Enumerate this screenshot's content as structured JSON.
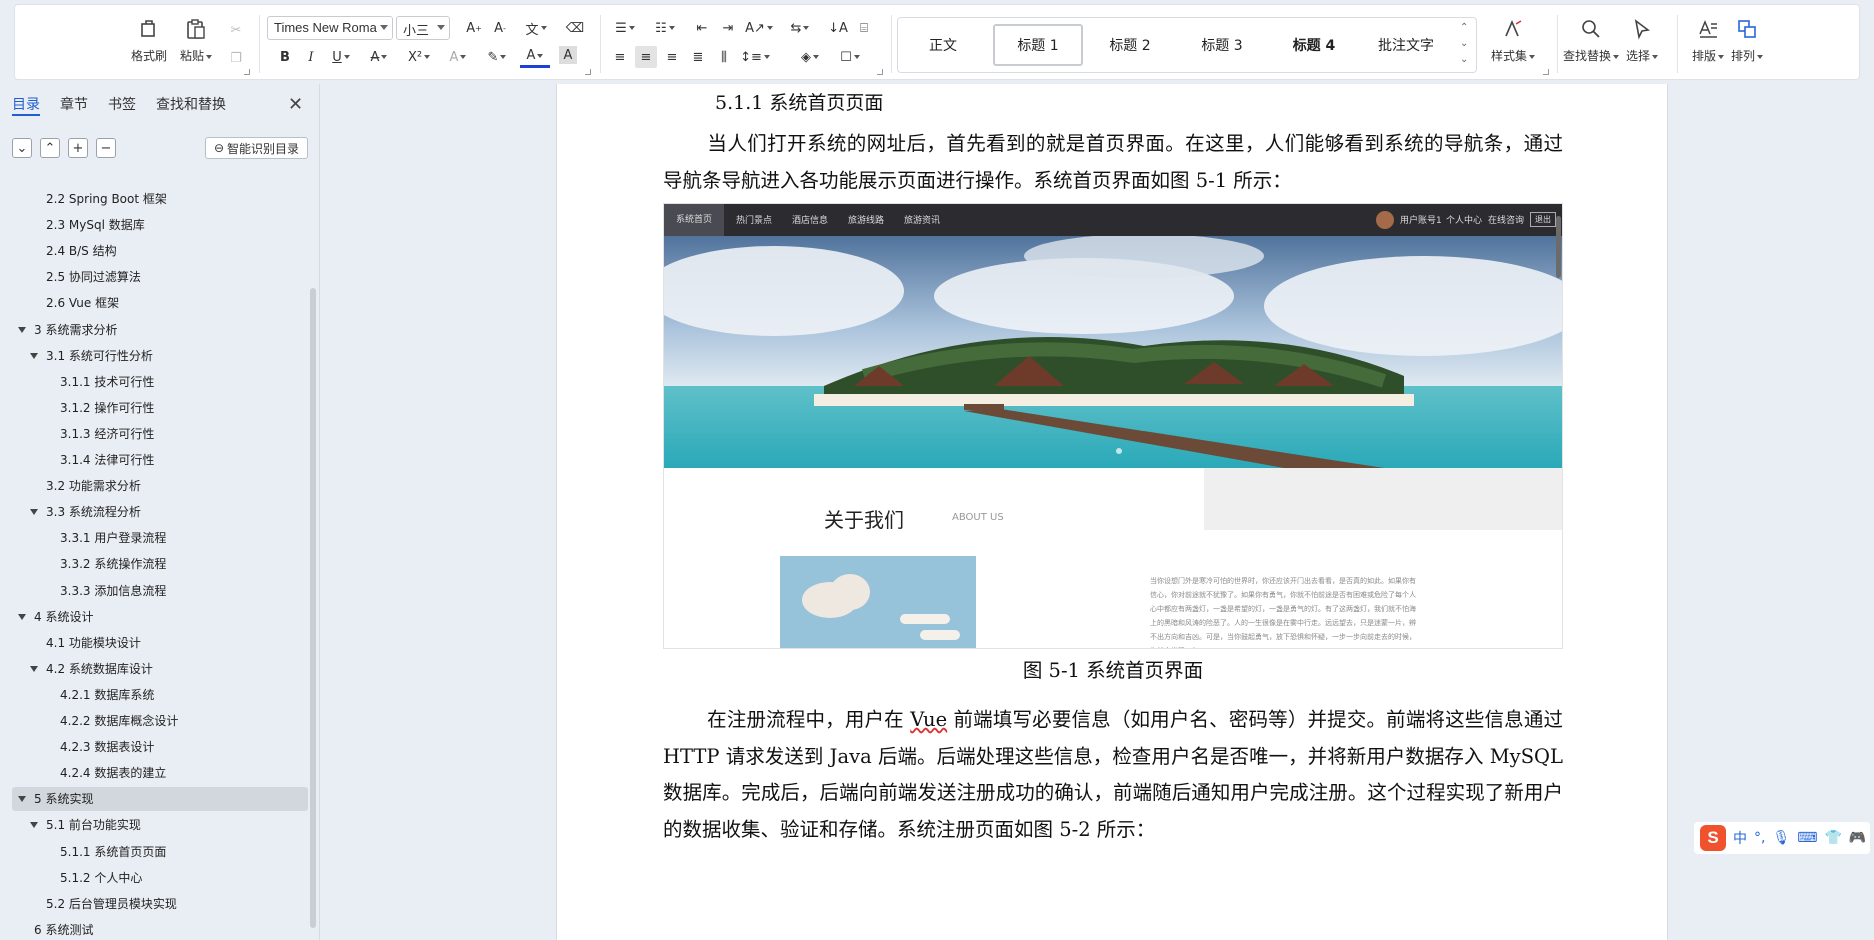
{
  "ribbon": {
    "format_painter": "格式刷",
    "paste": "粘贴",
    "font_name": "Times New Roma",
    "font_size": "小三",
    "styles": [
      "正文",
      "标题 1",
      "标题 2",
      "标题 3",
      "标题 4",
      "批注文字"
    ],
    "selected_style": "标题 1",
    "style_set": "样式集",
    "find_replace": "查找替换",
    "select": "选择",
    "layout": "排版",
    "arrange": "排列"
  },
  "nav": {
    "tabs": [
      "目录",
      "章节",
      "书签",
      "查找和替换"
    ],
    "smart_btn": "智能识别目录",
    "items": [
      {
        "label": "2.2 Spring Boot 框架",
        "level": 2
      },
      {
        "label": "2.3 MySql 数据库",
        "level": 2
      },
      {
        "label": "2.4 B/S 结构",
        "level": 2
      },
      {
        "label": "2.5  协同过滤算法",
        "level": 2
      },
      {
        "label": "2.6 Vue 框架",
        "level": 2
      },
      {
        "label": "3 系统需求分析",
        "level": 1
      },
      {
        "label": "3.1 系统可行性分析",
        "level": 2
      },
      {
        "label": "3.1.1  技术可行性",
        "level": 3
      },
      {
        "label": "3.1.2  操作可行性",
        "level": 3
      },
      {
        "label": "3.1.3  经济可行性",
        "level": 3
      },
      {
        "label": "3.1.4  法律可行性",
        "level": 3
      },
      {
        "label": "3.2  功能需求分析",
        "level": 2
      },
      {
        "label": "3.3  系统流程分析",
        "level": 2
      },
      {
        "label": "3.3.1  用户登录流程",
        "level": 3
      },
      {
        "label": "3.3.2  系统操作流程",
        "level": 3
      },
      {
        "label": "3.3.3  添加信息流程",
        "level": 3
      },
      {
        "label": "4 系统设计",
        "level": 1
      },
      {
        "label": "4.1  功能模块设计",
        "level": 2
      },
      {
        "label": "4.2  系统数据库设计",
        "level": 2
      },
      {
        "label": "4.2.1  数据库系统",
        "level": 3
      },
      {
        "label": "4.2.2  数据库概念设计",
        "level": 3
      },
      {
        "label": "4.2.3  数据表设计",
        "level": 3
      },
      {
        "label": "4.2.4  数据表的建立",
        "level": 3
      },
      {
        "label": "5 系统实现",
        "level": 1
      },
      {
        "label": "5.1 前台功能实现",
        "level": 2
      },
      {
        "label": "5.1.1 系统首页页面",
        "level": 3
      },
      {
        "label": "5.1.2 个人中心",
        "level": 3
      },
      {
        "label": "5.2 后台管理员模块实现",
        "level": 2
      },
      {
        "label": "6 系统测试",
        "level": 1
      }
    ],
    "current": "5 系统实现"
  },
  "doc": {
    "heading": "5.1.1 系统首页页面",
    "para1": "当人们打开系统的网址后，首先看到的就是首页界面。在这里，人们能够看到系统的导航条，通过导航条导航进入各功能展示页面进行操作。系统首页界面如图 5-1 所示：",
    "caption": "图 5-1  系统首页界面",
    "para2_a": "在注册流程中，用户在 ",
    "para2_vue": "Vue",
    "para2_b": " 前端填写必要信息（如用户名、密码等）并提交。前端将这些信息通过 HTTP 请求发送到 Java 后端。后端处理这些信息，检查用户名是否唯一，并将新用户数据存入 MySQL 数据库。完成后，后端向前端发送注册成功的确认，前端随后通知用户完成注册。这个过程实现了新用户的数据收集、验证和存储。系统注册页面如图 5-2 所示："
  },
  "figure": {
    "nav_items": [
      "系统首页",
      "热门景点",
      "酒店信息",
      "旅游线路",
      "旅游资讯"
    ],
    "nav_right": [
      "用户账号1",
      "个人中心",
      "在线咨询",
      "退出"
    ],
    "about_title": "关于我们",
    "about_sub": "ABOUT US",
    "about_text": "当你设想门外是寒冷可怕的世界时，你还应该开门出去看看，是否真的如此。如果你有信心，你对前途就不犹豫了。如果你有勇气，你就不怕前途是否有困难或危险了每个人心中都应有两盏灯，一盏是希望的灯，一盏是勇气的灯。有了这两盏灯，我们就不怕海上的黑暗和风涛的险恶了。人的一生很像是在雾中行走。远远望去，只是迷蒙一片，辨不出方向和吉凶。可是，当你鼓起勇气，放下恐惧和怀疑，一步一步向前走去的时候，你就会发现，每"
  },
  "ime": {
    "lang": "中"
  },
  "colors": {
    "accent": "#1f5fd1",
    "ime": "#f0522d"
  }
}
